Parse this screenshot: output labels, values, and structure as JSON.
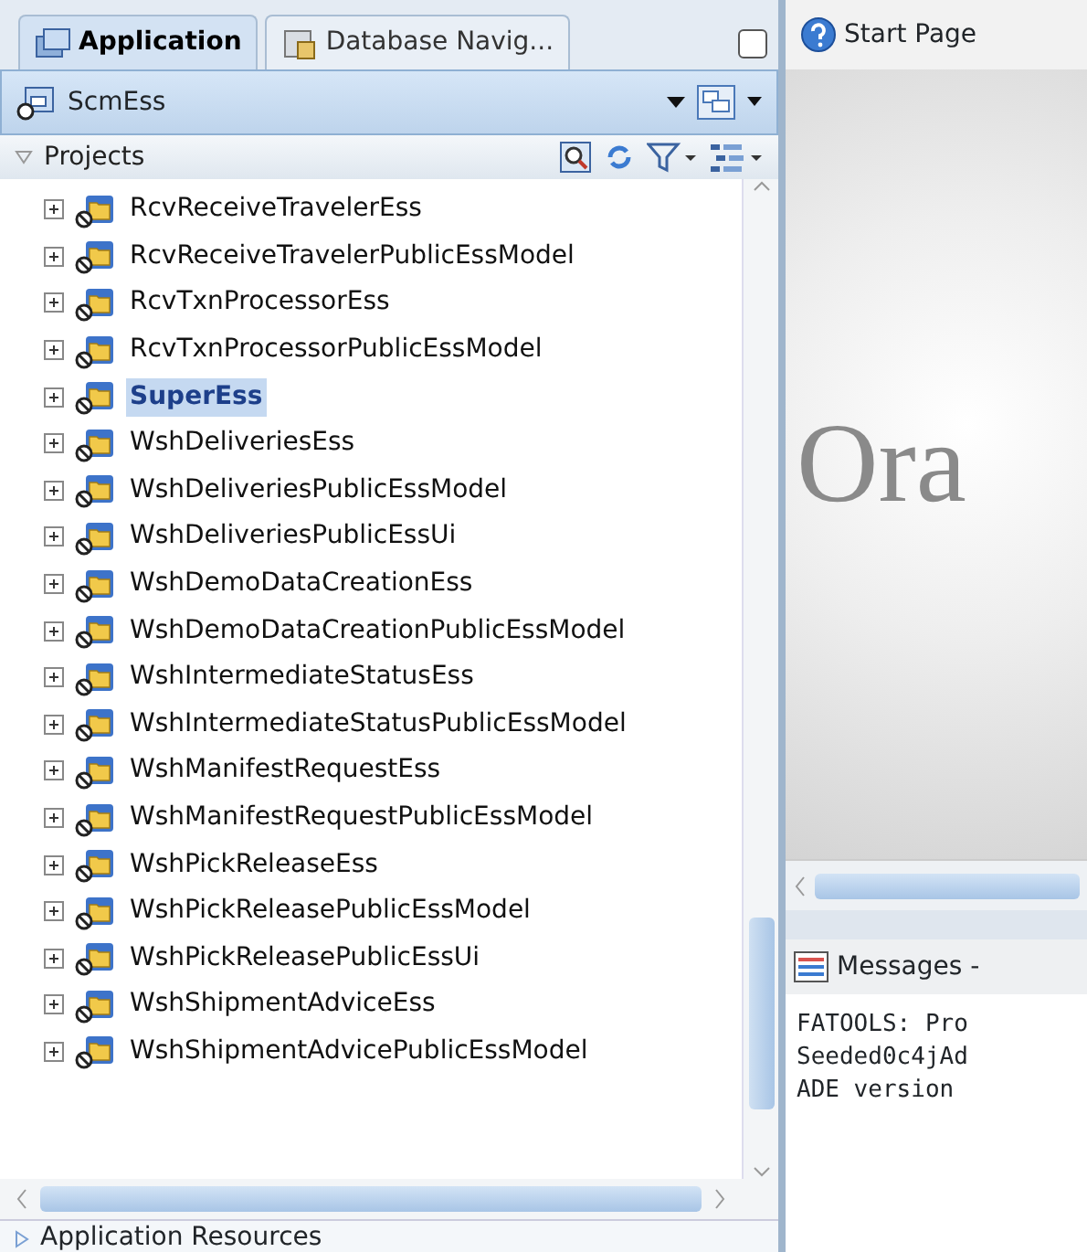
{
  "left_tabs": [
    {
      "label": "Application",
      "selected": true
    },
    {
      "label": "Database Navig...",
      "selected": false
    }
  ],
  "app_selector": {
    "value": "ScmEss"
  },
  "projects": {
    "title": "Projects",
    "expanded": true,
    "items": [
      {
        "label": "RcvReceiveTravelerEss",
        "selected": false
      },
      {
        "label": "RcvReceiveTravelerPublicEssModel",
        "selected": false
      },
      {
        "label": "RcvTxnProcessorEss",
        "selected": false
      },
      {
        "label": "RcvTxnProcessorPublicEssModel",
        "selected": false
      },
      {
        "label": "SuperEss",
        "selected": true
      },
      {
        "label": "WshDeliveriesEss",
        "selected": false
      },
      {
        "label": "WshDeliveriesPublicEssModel",
        "selected": false
      },
      {
        "label": "WshDeliveriesPublicEssUi",
        "selected": false
      },
      {
        "label": "WshDemoDataCreationEss",
        "selected": false
      },
      {
        "label": "WshDemoDataCreationPublicEssModel",
        "selected": false
      },
      {
        "label": "WshIntermediateStatusEss",
        "selected": false
      },
      {
        "label": "WshIntermediateStatusPublicEssModel",
        "selected": false
      },
      {
        "label": "WshManifestRequestEss",
        "selected": false
      },
      {
        "label": "WshManifestRequestPublicEssModel",
        "selected": false
      },
      {
        "label": "WshPickReleaseEss",
        "selected": false
      },
      {
        "label": "WshPickReleasePublicEssModel",
        "selected": false
      },
      {
        "label": "WshPickReleasePublicEssUi",
        "selected": false
      },
      {
        "label": "WshShipmentAdviceEss",
        "selected": false
      },
      {
        "label": "WshShipmentAdvicePublicEssModel",
        "selected": false
      }
    ]
  },
  "resources": {
    "title": "Application Resources",
    "expanded": false
  },
  "editor_tab": {
    "label": "Start Page"
  },
  "start_page": {
    "logo_text": "Ora"
  },
  "messages": {
    "title": "Messages - ",
    "lines": [
      "FATOOLS: Pro",
      "Seeded0c4jAd",
      "ADE version "
    ]
  }
}
